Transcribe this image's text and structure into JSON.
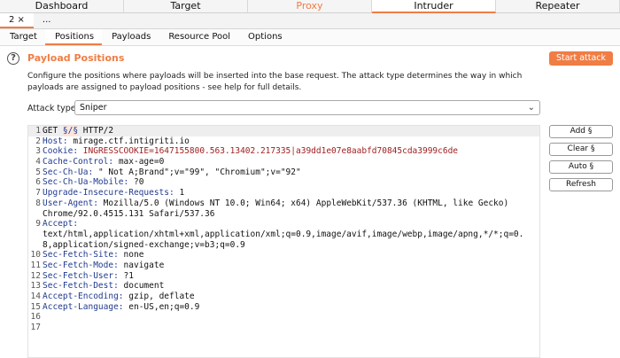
{
  "main_tabs": [
    "Dashboard",
    "Target",
    "Proxy",
    "Intruder",
    "Repeater"
  ],
  "intruder_tabs": [
    "2 ×",
    "..."
  ],
  "section_tabs": [
    "Target",
    "Positions",
    "Payloads",
    "Resource Pool",
    "Options"
  ],
  "panel": {
    "help_icon": "?",
    "title": "Payload Positions",
    "description": "Configure the positions where payloads will be inserted into the base request. The attack type determines the way in which payloads are assigned to payload positions - see help for full details.",
    "start_button": "Start attack",
    "attack_type_label": "Attack type:",
    "attack_type_value": "Sniper"
  },
  "buttons": {
    "add": "Add §",
    "clear": "Clear §",
    "auto": "Auto §",
    "refresh": "Refresh"
  },
  "request": {
    "line1_method": "GET ",
    "line1_payload": "§/§",
    "line1_rest": " HTTP/2",
    "headers": [
      {
        "n": "2",
        "name": "Host",
        "value": " mirage.ctf.intigriti.io"
      },
      {
        "n": "3",
        "name": "Cookie",
        "value": " INGRESSCOOKIE=1647155800.563.13402.217335|a39dd1e07e8aabfd70845cda3999c6de"
      },
      {
        "n": "4",
        "name": "Cache-Control",
        "value": " max-age=0"
      },
      {
        "n": "5",
        "name": "Sec-Ch-Ua",
        "value": " \" Not A;Brand\";v=\"99\", \"Chromium\";v=\"92\""
      },
      {
        "n": "6",
        "name": "Sec-Ch-Ua-Mobile",
        "value": " ?0"
      },
      {
        "n": "7",
        "name": "Upgrade-Insecure-Requests",
        "value": " 1"
      },
      {
        "n": "8",
        "name": "User-Agent",
        "value": " Mozilla/5.0 (Windows NT 10.0; Win64; x64) AppleWebKit/537.36 (KHTML, like Gecko)"
      },
      {
        "n": "",
        "name": "",
        "value": "Chrome/92.0.4515.131 Safari/537.36"
      },
      {
        "n": "9",
        "name": "Accept",
        "value": ""
      },
      {
        "n": "",
        "name": "",
        "value": "text/html,application/xhtml+xml,application/xml;q=0.9,image/avif,image/webp,image/apng,*/*;q=0."
      },
      {
        "n": "",
        "name": "",
        "value": "8,application/signed-exchange;v=b3;q=0.9"
      },
      {
        "n": "10",
        "name": "Sec-Fetch-Site",
        "value": " none"
      },
      {
        "n": "11",
        "name": "Sec-Fetch-Mode",
        "value": " navigate"
      },
      {
        "n": "12",
        "name": "Sec-Fetch-User",
        "value": " ?1"
      },
      {
        "n": "13",
        "name": "Sec-Fetch-Dest",
        "value": " document"
      },
      {
        "n": "14",
        "name": "Accept-Encoding",
        "value": " gzip, deflate"
      },
      {
        "n": "15",
        "name": "Accept-Language",
        "value": " en-US,en;q=0.9"
      },
      {
        "n": "16",
        "name": "",
        "value": ""
      },
      {
        "n": "17",
        "name": "",
        "value": ""
      }
    ]
  }
}
